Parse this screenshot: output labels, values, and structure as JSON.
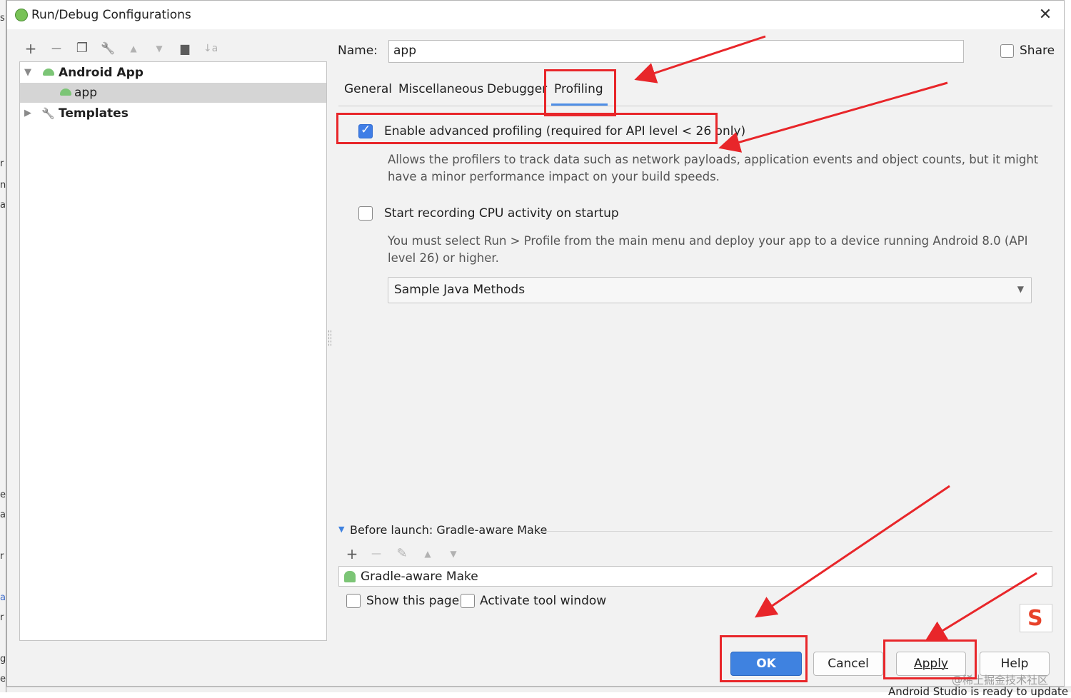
{
  "window": {
    "title": "Run/Debug Configurations",
    "close_glyph": "✕"
  },
  "left_toolbar": {
    "icons": [
      "add-icon",
      "remove-icon",
      "copy-icon",
      "wrench-icon",
      "move-up-icon",
      "move-down-icon",
      "folder-icon",
      "sort-icon"
    ],
    "glyphs": {
      "add": "+",
      "remove": "—",
      "copy": "❐",
      "edit": "🔧",
      "up": "▲",
      "down": "▼",
      "folder": "▆",
      "sort": "↓a"
    }
  },
  "tree": {
    "items": [
      {
        "label": "Android App",
        "bold": true
      },
      {
        "label": "app",
        "selected": true
      },
      {
        "label": "Templates",
        "bold": true
      }
    ],
    "expand_glyph": "▼",
    "collapsed_glyph": "▶"
  },
  "config": {
    "name_label": "Name:",
    "name_value": "app",
    "share_label": "Share"
  },
  "tabs": [
    "General",
    "Miscellaneous",
    "Debugger",
    "Profiling"
  ],
  "active_tab": "Profiling",
  "profiling": {
    "advanced_label": "Enable advanced profiling (required for API level < 26 only)",
    "advanced_checked": true,
    "advanced_help_1": "Allows the profilers to track data such as network payloads, application events and object counts, but it might",
    "advanced_help_2": "have a minor performance impact on your build speeds.",
    "cpu_label": "Start recording CPU activity on startup",
    "cpu_checked": false,
    "cpu_help_1": "You must select Run > Profile from the main menu and deploy your app to a device running Android 8.0 (API",
    "cpu_help_2": "level 26) or higher.",
    "method_selected": "Sample Java Methods",
    "caret": "▼"
  },
  "before_launch": {
    "header": "Before launch: Gradle-aware Make",
    "triangle": "▼",
    "toolbar_glyphs": {
      "add": "+",
      "remove": "—",
      "edit": "✎",
      "up": "▲",
      "down": "▼"
    },
    "task": "Gradle-aware Make",
    "show_page_label": "Show this page",
    "activate_label": "Activate tool window"
  },
  "buttons": {
    "ok": "OK",
    "cancel": "Cancel",
    "apply": "Apply",
    "help": "Help"
  },
  "background": {
    "left_chars": [
      "s",
      "r",
      "n",
      "a",
      "e",
      "a",
      "r",
      "a",
      "r",
      "g",
      "e"
    ],
    "status": "Android Studio is ready to update",
    "watermark": "@稀土掘金技术社区",
    "sogou": "S"
  },
  "annotation_color": "#e8262a",
  "accent_color": "#3f82e0"
}
